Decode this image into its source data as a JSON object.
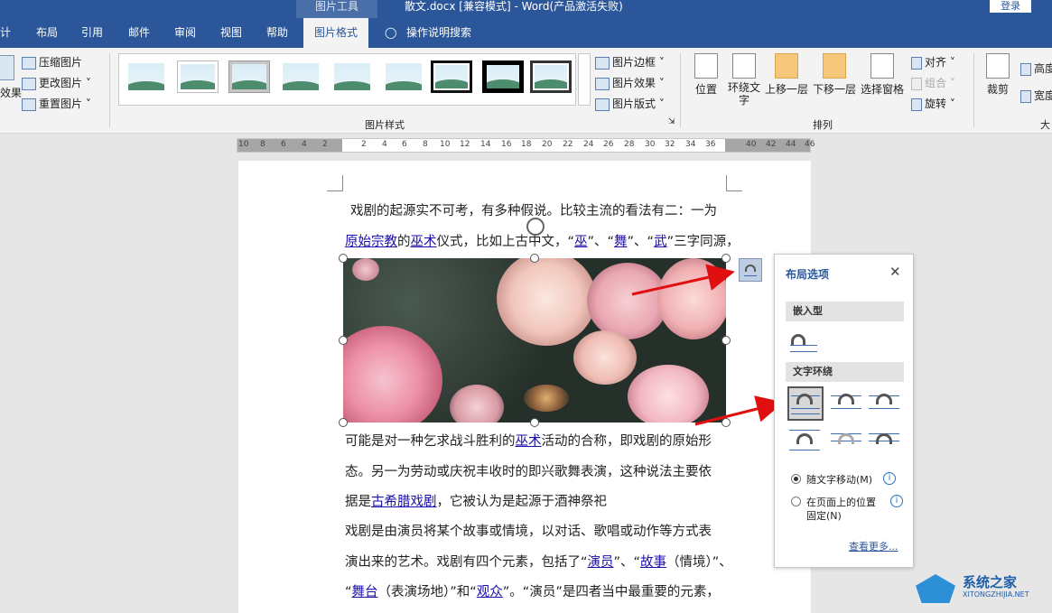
{
  "titlebar": {
    "context": "图片工具",
    "doc": "散文.docx [兼容模式]  -  Word(产品激活失败)",
    "login": "登录"
  },
  "tabs": [
    "计",
    "布局",
    "引用",
    "邮件",
    "审阅",
    "视图",
    "帮助",
    "图片格式",
    "操作说明搜索"
  ],
  "ribbon": {
    "adjust": {
      "effects": "效果",
      "compress": "压缩图片",
      "change": "更改图片",
      "reset": "重置图片"
    },
    "styles": {
      "group": "图片样式",
      "border": "图片边框",
      "effect": "图片效果",
      "layout": "图片版式"
    },
    "arrange": {
      "position": "位置",
      "wrap": "环绕文字",
      "forward": "上移一层",
      "backward": "下移一层",
      "pane": "选择窗格",
      "align": "对齐",
      "group": "组合",
      "rotate": "旋转",
      "label": "排列"
    },
    "size": {
      "crop": "裁剪",
      "height": "高度",
      "width": "宽度",
      "label": "大"
    }
  },
  "ruler": [
    "10",
    "8",
    "6",
    "4",
    "2",
    "2",
    "4",
    "6",
    "8",
    "10",
    "12",
    "14",
    "16",
    "18",
    "20",
    "22",
    "24",
    "26",
    "28",
    "30",
    "32",
    "34",
    "36",
    "40",
    "42",
    "44",
    "46"
  ],
  "document": {
    "line1": "戏剧的起源实不可考，有多种假说。比较主流的看法有二：一为",
    "line2": [
      {
        "t": "原始宗教",
        "link": true
      },
      {
        "t": "的"
      },
      {
        "t": "巫术",
        "link": true
      },
      {
        "t": "仪式，比如上古中文，“"
      },
      {
        "t": "巫",
        "link": true
      },
      {
        "t": "”、“"
      },
      {
        "t": "舞",
        "link": true
      },
      {
        "t": "”、“"
      },
      {
        "t": "武",
        "link": true
      },
      {
        "t": "”三字同源，"
      }
    ],
    "line3": [
      {
        "t": "可能是对一种乞求战斗胜利的"
      },
      {
        "t": "巫术",
        "link": true
      },
      {
        "t": "活动的合称，即戏剧的原始形"
      }
    ],
    "line4": "态。另一为劳动或庆祝丰收时的即兴歌舞表演，这种说法主要依",
    "line5": [
      {
        "t": "据是"
      },
      {
        "t": "古希腊戏剧",
        "link": true
      },
      {
        "t": "，它被认为是起源于酒神祭祀"
      }
    ],
    "line6": "戏剧是由演员将某个故事或情境，以对话、歌唱或动作等方式表",
    "line7": [
      {
        "t": "演出来的艺术。戏剧有四个元素，包括了“"
      },
      {
        "t": "演员",
        "link": true
      },
      {
        "t": "”、“"
      },
      {
        "t": "故事",
        "link": true
      },
      {
        "t": "（情境）”、"
      }
    ],
    "line8": [
      {
        "t": "“"
      },
      {
        "t": "舞台",
        "link": true
      },
      {
        "t": "（表演场地）”和“"
      },
      {
        "t": "观众",
        "link": true
      },
      {
        "t": "”。“演员”是四者当中最重要的元素，"
      }
    ]
  },
  "panel": {
    "title": "布局选项",
    "inline": "嵌入型",
    "wrap": "文字环绕",
    "move": "随文字移动(M)",
    "fixed1": "在页面上的位置",
    "fixed2": "固定(N)",
    "more": "查看更多..."
  },
  "watermark": {
    "name": "系统之家",
    "url": "XITONGZHIJIA.NET"
  }
}
